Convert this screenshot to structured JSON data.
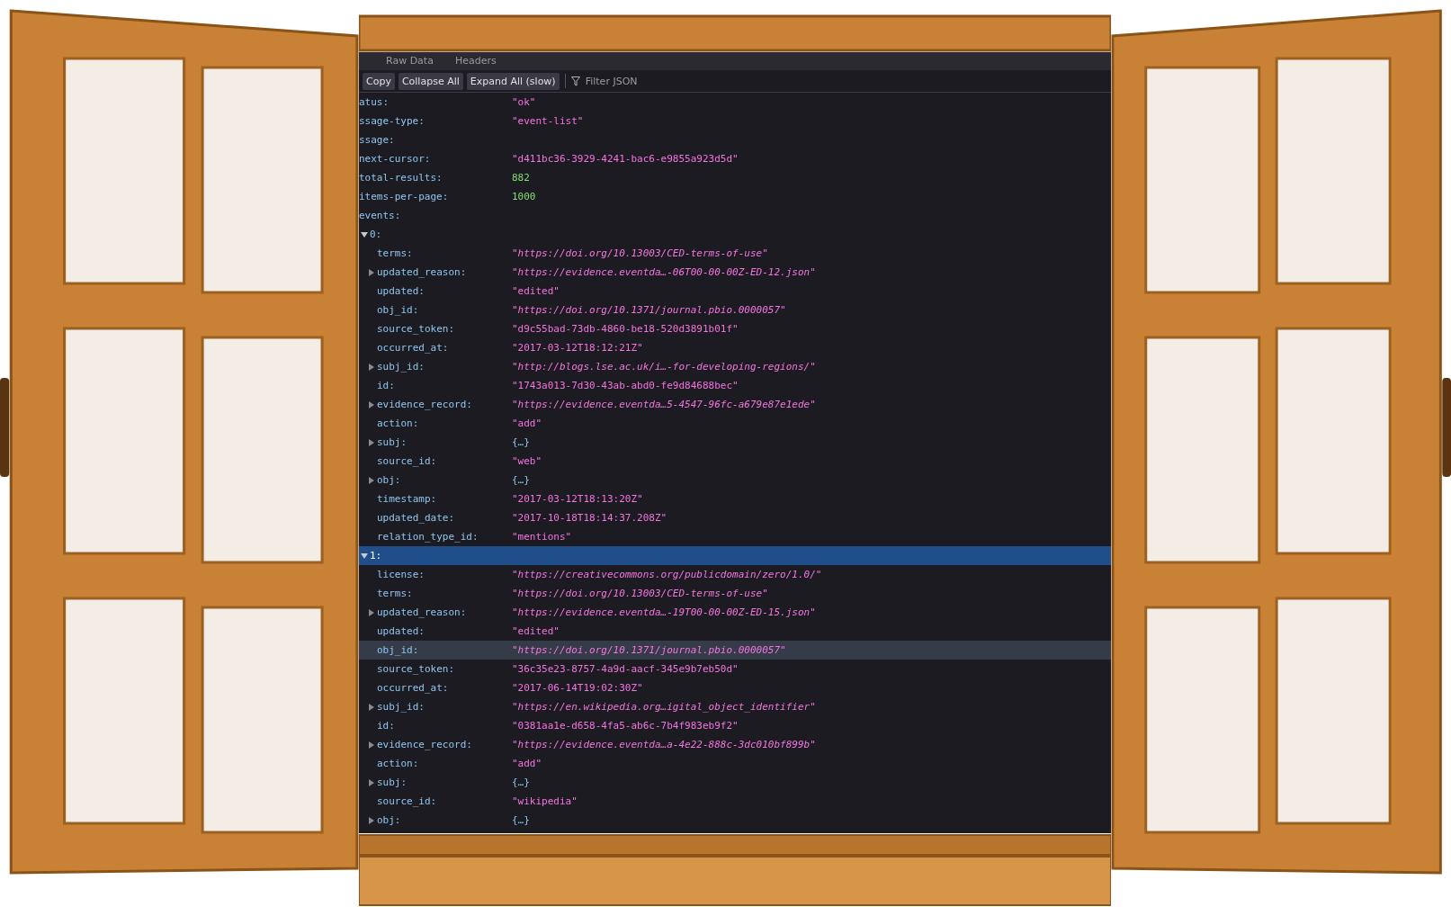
{
  "tabs": [
    {
      "label": "Raw Data",
      "selected": false
    },
    {
      "label": "Headers",
      "selected": false
    }
  ],
  "toolbar": {
    "buttons": [
      "Copy",
      "Collapse All",
      "Expand All (slow)"
    ],
    "filter": {
      "placeholder": "Filter JSON"
    }
  },
  "tree": [
    {
      "key": "atus:",
      "value": "\"ok\"",
      "kind": "string",
      "selected": false,
      "highlighted": false
    },
    {
      "key": "ssage-type:",
      "value": "\"event-list\"",
      "kind": "string",
      "selected": false,
      "highlighted": false
    },
    {
      "key": "ssage:",
      "selected": false,
      "highlighted": false,
      "children": [
        {
          "key": "next-cursor:",
          "value": "\"d411bc36-3929-4241-bac6-e9855a923d5d\"",
          "kind": "string",
          "selected": false,
          "highlighted": false
        },
        {
          "key": "total-results:",
          "value": "882",
          "kind": "number",
          "selected": false,
          "highlighted": false
        },
        {
          "key": "items-per-page:",
          "value": "1000",
          "kind": "number",
          "selected": false,
          "highlighted": false
        },
        {
          "key": "events:",
          "selected": false,
          "highlighted": false,
          "children": [
            {
              "key": "0:",
              "expanded": true,
              "selected": false,
              "highlighted": false,
              "children": [
                {
                  "key": "terms:",
                  "value": "\"https://doi.org/10.13003/CED-terms-of-use\"",
                  "kind": "url",
                  "selected": false,
                  "highlighted": false
                },
                {
                  "key": "updated_reason:",
                  "value": "\"https://evidence.eventda…-06T00-00-00Z-ED-12.json\"",
                  "kind": "url",
                  "expanded": false,
                  "selected": false,
                  "highlighted": false
                },
                {
                  "key": "updated:",
                  "value": "\"edited\"",
                  "kind": "string",
                  "selected": false,
                  "highlighted": false
                },
                {
                  "key": "obj_id:",
                  "value": "\"https://doi.org/10.1371/journal.pbio.0000057\"",
                  "kind": "url",
                  "selected": false,
                  "highlighted": false
                },
                {
                  "key": "source_token:",
                  "value": "\"d9c55bad-73db-4860-be18-520d3891b01f\"",
                  "kind": "string",
                  "selected": false,
                  "highlighted": false
                },
                {
                  "key": "occurred_at:",
                  "value": "\"2017-03-12T18:12:21Z\"",
                  "kind": "string",
                  "selected": false,
                  "highlighted": false
                },
                {
                  "key": "subj_id:",
                  "value": "\"http://blogs.lse.ac.uk/i…-for-developing-regions/\"",
                  "kind": "url",
                  "expanded": false,
                  "selected": false,
                  "highlighted": false
                },
                {
                  "key": "id:",
                  "value": "\"1743a013-7d30-43ab-abd0-fe9d84688bec\"",
                  "kind": "string",
                  "selected": false,
                  "highlighted": false
                },
                {
                  "key": "evidence_record:",
                  "value": "\"https://evidence.eventda…5-4547-96fc-a679e87e1ede\"",
                  "kind": "url",
                  "expanded": false,
                  "selected": false,
                  "highlighted": false
                },
                {
                  "key": "action:",
                  "value": "\"add\"",
                  "kind": "string",
                  "selected": false,
                  "highlighted": false
                },
                {
                  "key": "subj:",
                  "value": "{…}",
                  "kind": "object",
                  "expanded": false,
                  "selected": false,
                  "highlighted": false
                },
                {
                  "key": "source_id:",
                  "value": "\"web\"",
                  "kind": "string",
                  "selected": false,
                  "highlighted": false
                },
                {
                  "key": "obj:",
                  "value": "{…}",
                  "kind": "object",
                  "expanded": false,
                  "selected": false,
                  "highlighted": false
                },
                {
                  "key": "timestamp:",
                  "value": "\"2017-03-12T18:13:20Z\"",
                  "kind": "string",
                  "selected": false,
                  "highlighted": false
                },
                {
                  "key": "updated_date:",
                  "value": "\"2017-10-18T18:14:37.208Z\"",
                  "kind": "string",
                  "selected": false,
                  "highlighted": false
                },
                {
                  "key": "relation_type_id:",
                  "value": "\"mentions\"",
                  "kind": "string",
                  "selected": false,
                  "highlighted": false
                }
              ]
            },
            {
              "key": "1:",
              "expanded": true,
              "selected": true,
              "highlighted": false,
              "children": [
                {
                  "key": "license:",
                  "value": "\"https://creativecommons.org/publicdomain/zero/1.0/\"",
                  "kind": "url",
                  "selected": false,
                  "highlighted": false
                },
                {
                  "key": "terms:",
                  "value": "\"https://doi.org/10.13003/CED-terms-of-use\"",
                  "kind": "url",
                  "selected": false,
                  "highlighted": false
                },
                {
                  "key": "updated_reason:",
                  "value": "\"https://evidence.eventda…-19T00-00-00Z-ED-15.json\"",
                  "kind": "url",
                  "expanded": false,
                  "selected": false,
                  "highlighted": false
                },
                {
                  "key": "updated:",
                  "value": "\"edited\"",
                  "kind": "string",
                  "selected": false,
                  "highlighted": false
                },
                {
                  "key": "obj_id:",
                  "value": "\"https://doi.org/10.1371/journal.pbio.0000057\"",
                  "kind": "url",
                  "selected": false,
                  "highlighted": true
                },
                {
                  "key": "source_token:",
                  "value": "\"36c35e23-8757-4a9d-aacf-345e9b7eb50d\"",
                  "kind": "string",
                  "selected": false,
                  "highlighted": false
                },
                {
                  "key": "occurred_at:",
                  "value": "\"2017-06-14T19:02:30Z\"",
                  "kind": "string",
                  "selected": false,
                  "highlighted": false
                },
                {
                  "key": "subj_id:",
                  "value": "\"https://en.wikipedia.org…igital_object_identifier\"",
                  "kind": "url",
                  "expanded": false,
                  "selected": false,
                  "highlighted": false
                },
                {
                  "key": "id:",
                  "value": "\"0381aa1e-d658-4fa5-ab6c-7b4f983eb9f2\"",
                  "kind": "string",
                  "selected": false,
                  "highlighted": false
                },
                {
                  "key": "evidence_record:",
                  "value": "\"https://evidence.eventda…a-4e22-888c-3dc010bf899b\"",
                  "kind": "url",
                  "expanded": false,
                  "selected": false,
                  "highlighted": false
                },
                {
                  "key": "action:",
                  "value": "\"add\"",
                  "kind": "string",
                  "selected": false,
                  "highlighted": false
                },
                {
                  "key": "subj:",
                  "value": "{…}",
                  "kind": "object",
                  "expanded": false,
                  "selected": false,
                  "highlighted": false
                },
                {
                  "key": "source_id:",
                  "value": "\"wikipedia\"",
                  "kind": "string",
                  "selected": false,
                  "highlighted": false
                },
                {
                  "key": "obj:",
                  "value": "{…}",
                  "kind": "object",
                  "expanded": false,
                  "selected": false,
                  "highlighted": false
                }
              ]
            }
          ]
        }
      ]
    }
  ]
}
